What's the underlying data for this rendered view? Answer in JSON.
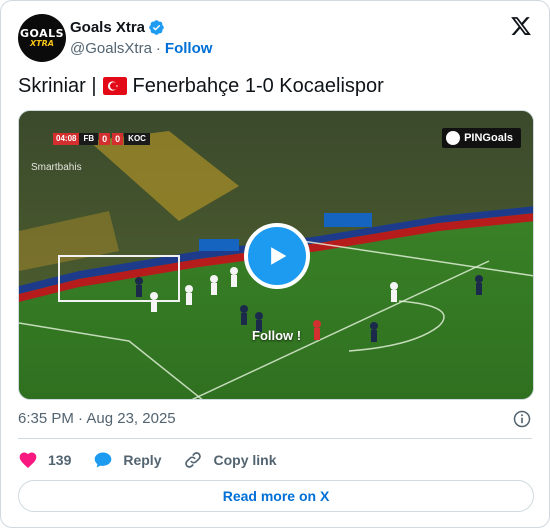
{
  "author": {
    "display_name": "Goals Xtra",
    "handle": "@GoalsXtra",
    "separator": "·",
    "follow_label": "Follow",
    "avatar_text_top": "GOALS",
    "avatar_text_bottom": "XTRA",
    "verified": true
  },
  "tweet": {
    "text_before_flag": "Skriniar |",
    "flag": "turkey-flag",
    "text_after_flag": "Fenerbahçe 1-0 Kocaelispor"
  },
  "media": {
    "type": "video",
    "scorebug": {
      "time": "04:08",
      "home": "FB",
      "home_score": "0",
      "away_score": "0",
      "away": "KOC"
    },
    "sponsor": "Smartbahis",
    "watermark": "PINGoals",
    "overlay_text": "Follow !"
  },
  "meta": {
    "time": "6:35 PM",
    "separator": "·",
    "date": "Aug 23, 2025"
  },
  "actions": {
    "like_count": "139",
    "reply_label": "Reply",
    "copy_link_label": "Copy link"
  },
  "read_more_label": "Read more on X",
  "colors": {
    "link": "#006fd6",
    "verified": "#1d9bf0",
    "like": "#f91880",
    "reply": "#1d9bf0",
    "text_secondary": "#536471"
  }
}
